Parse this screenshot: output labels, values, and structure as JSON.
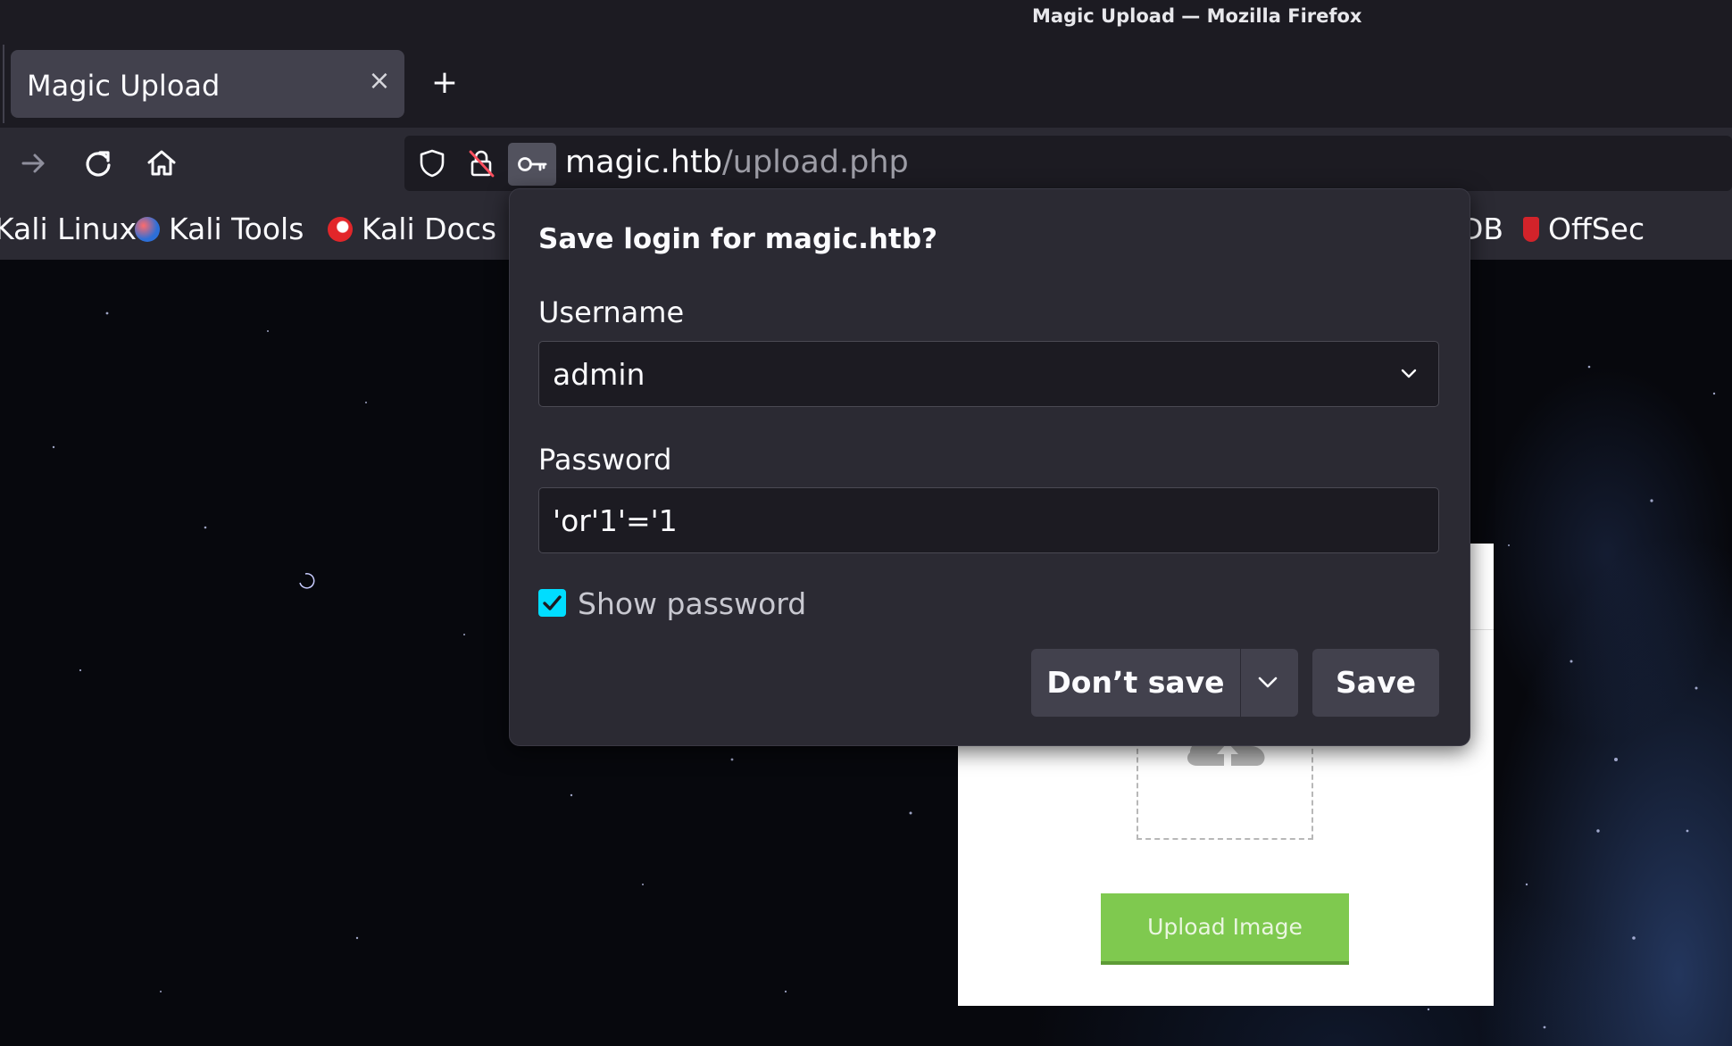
{
  "window": {
    "title": "Magic Upload — Mozilla Firefox"
  },
  "tab": {
    "label": "Magic Upload",
    "close_glyph": "×",
    "new_tab_glyph": "+"
  },
  "navbar": {
    "url_host": "magic.htb",
    "url_path": "/upload.php",
    "icons": [
      "forward-icon",
      "reload-icon",
      "home-icon",
      "shield-icon",
      "insecure-lock-icon",
      "key-icon"
    ]
  },
  "bookmarks": [
    {
      "label": "Kali Linux",
      "icon": "kali-icon"
    },
    {
      "label": "Kali Tools",
      "icon": "kali-tools-icon"
    },
    {
      "label": "Kali Docs",
      "icon": "kali-docs-icon"
    },
    {
      "label": "DB",
      "icon": "exploit-db-icon"
    },
    {
      "label": "OffSec",
      "icon": "offsec-icon"
    }
  ],
  "page": {
    "upload_button_label": "Upload Image"
  },
  "popup": {
    "title": "Save login for magic.htb?",
    "username_label": "Username",
    "username_value": "admin",
    "password_label": "Password",
    "password_value": "'or'1'='1",
    "show_password_label": "Show password",
    "show_password_checked": true,
    "dont_save_label": "Don’t save",
    "save_label": "Save"
  },
  "colors": {
    "accent": "#00ddff",
    "upload_button": "#7fc94f",
    "panel": "#2b2a33"
  }
}
